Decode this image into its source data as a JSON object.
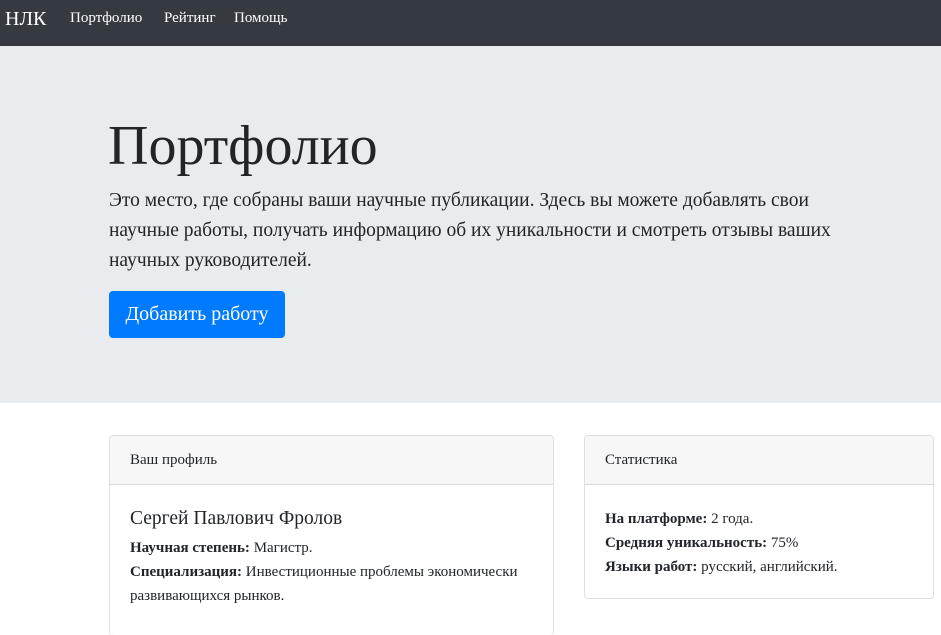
{
  "navbar": {
    "brand": "НЛК",
    "links": [
      {
        "label": "Портфолио"
      },
      {
        "label": "Рейтинг"
      },
      {
        "label": "Помощь"
      }
    ]
  },
  "hero": {
    "title": "Портфолио",
    "lead": "Это место, где собраны ваши научные публикации. Здесь вы можете добавлять свои научные работы, получать информацию об их уникальности и смотреть отзывы ваших научных руководителей.",
    "button_label": "Добавить работу"
  },
  "profile_card": {
    "header": "Ваш профиль",
    "name": "Сергей Павлович Фролов",
    "degree_label": "Научная степень:",
    "degree_value": " Магистр.",
    "specialization_label": "Специализация:",
    "specialization_value": " Инвестиционные проблемы экономически развивающихся рынков."
  },
  "stats_card": {
    "header": "Статистика",
    "platform_label": "На платформе:",
    "platform_value": " 2 года.",
    "uniqueness_label": "Средняя уникальность:",
    "uniqueness_value": " 75%",
    "languages_label": "Языки работ:",
    "languages_value": " русский, английский."
  },
  "colors": {
    "navbar_bg": "#343a40",
    "jumbotron_bg": "#e9ecef",
    "primary": "#007bff"
  }
}
